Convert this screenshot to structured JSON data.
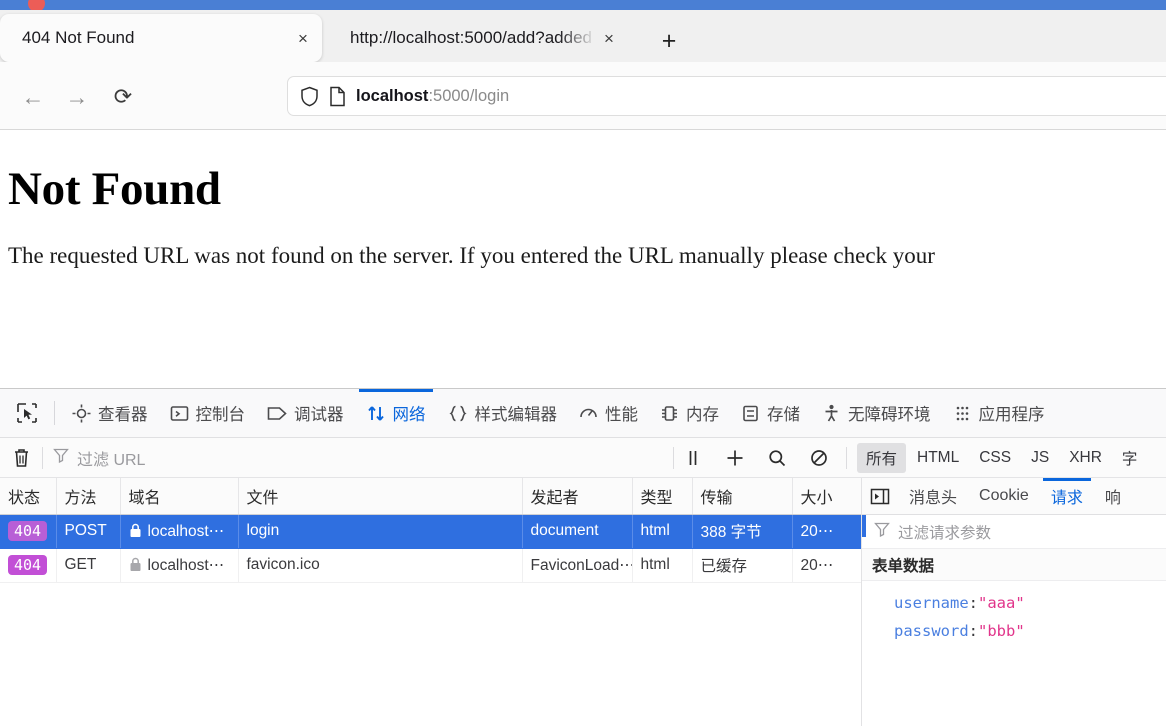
{
  "browser": {
    "tabs": [
      {
        "title": "404 Not Found",
        "close": "×",
        "active": true
      },
      {
        "title": "http://localhost:5000/add?added",
        "close": "×",
        "active": false
      }
    ],
    "new_tab_label": "+",
    "nav": {
      "back": "←",
      "forward": "→",
      "reload": "⟳"
    },
    "urlbar": {
      "host": "localhost",
      "path": ":5000/login",
      "full": "localhost:5000/login",
      "shield_icon": "shield-icon",
      "page-icon": "page-icon"
    },
    "accent_color": "#4a7fd4"
  },
  "page": {
    "heading": "Not Found",
    "body": "The requested URL was not found on the server. If you entered the URL manually please check your"
  },
  "devtools": {
    "tabs": [
      {
        "label": "查看器",
        "icon": "inspector-icon",
        "active": false
      },
      {
        "label": "控制台",
        "icon": "console-icon",
        "active": false
      },
      {
        "label": "调试器",
        "icon": "debugger-icon",
        "active": false
      },
      {
        "label": "网络",
        "icon": "network-icon",
        "active": true
      },
      {
        "label": "样式编辑器",
        "icon": "style-editor-icon",
        "active": false
      },
      {
        "label": "性能",
        "icon": "performance-icon",
        "active": false
      },
      {
        "label": "内存",
        "icon": "memory-icon",
        "active": false
      },
      {
        "label": "存储",
        "icon": "storage-icon",
        "active": false
      },
      {
        "label": "无障碍环境",
        "icon": "accessibility-icon",
        "active": false
      },
      {
        "label": "应用程序",
        "icon": "application-icon",
        "active": false
      }
    ],
    "picker_icon": "element-picker-icon",
    "filterbar": {
      "trash_icon": "trash-icon",
      "filter_placeholder": "过滤 URL",
      "filter_value": "",
      "filter_icon": "funnel-icon",
      "icons": [
        {
          "name": "pause-icon",
          "glyph": "||"
        },
        {
          "name": "plus-icon",
          "glyph": "+"
        },
        {
          "name": "search-icon",
          "glyph": "search"
        },
        {
          "name": "block-icon",
          "glyph": "block"
        }
      ],
      "types": [
        {
          "label": "所有",
          "active": true
        },
        {
          "label": "HTML",
          "active": false
        },
        {
          "label": "CSS",
          "active": false
        },
        {
          "label": "JS",
          "active": false
        },
        {
          "label": "XHR",
          "active": false
        },
        {
          "label": "字",
          "active": false
        }
      ]
    },
    "network": {
      "columns": [
        "状态",
        "方法",
        "域名",
        "文件",
        "发起者",
        "类型",
        "传输",
        "大小"
      ],
      "rows": [
        {
          "status": "404",
          "method": "POST",
          "domain": "localhost⋯",
          "file": "login",
          "initiator": "document",
          "type": "html",
          "transferred": "388 字节",
          "size": "20⋯",
          "selected": true,
          "lock_icon": "lock-icon"
        },
        {
          "status": "404",
          "method": "GET",
          "domain": "localhost⋯",
          "file": "favicon.ico",
          "initiator": "FaviconLoad⋯",
          "type": "html",
          "transferred": "已缓存",
          "size": "20⋯",
          "selected": false,
          "lock_icon": "lock-icon"
        }
      ],
      "status_badge_color": "#c24fd6",
      "selected_row_color": "#2f6fe0"
    },
    "sidepanel": {
      "toggle_icon": "panel-toggle-icon",
      "tabs": [
        {
          "label": "消息头",
          "active": false
        },
        {
          "label": "Cookie",
          "active": false
        },
        {
          "label": "请求",
          "active": true
        },
        {
          "label": "响",
          "active": false
        }
      ],
      "filter_placeholder": "过滤请求参数",
      "filter_icon": "funnel-icon",
      "section_title": "表单数据",
      "params": [
        {
          "key": "username",
          "sep": ": ",
          "value": "\"aaa\""
        },
        {
          "key": "password",
          "sep": ": ",
          "value": "\"bbb\""
        }
      ]
    }
  }
}
